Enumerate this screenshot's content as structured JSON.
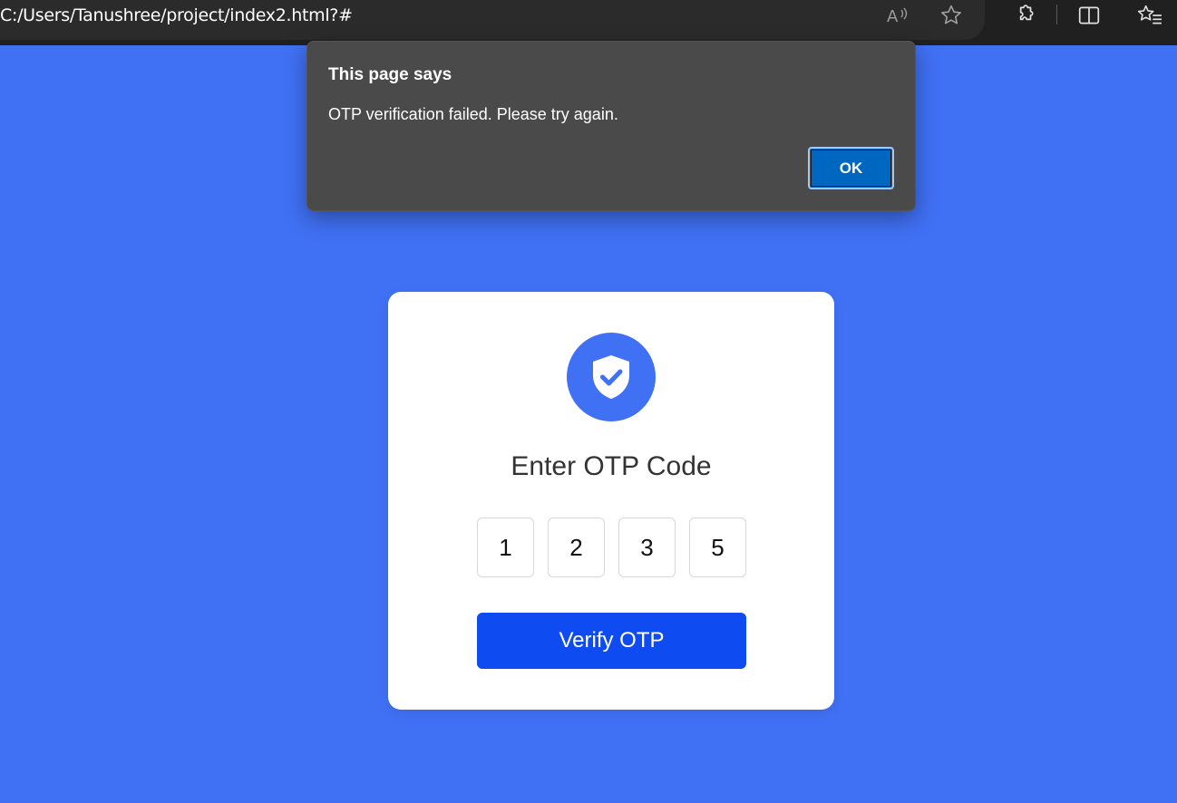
{
  "browser": {
    "url": "C:/Users/Tanushree/project/index2.html?#",
    "icons": [
      "read-aloud-icon",
      "favorite-star-icon",
      "extensions-icon",
      "split-screen-icon",
      "favorites-list-icon"
    ]
  },
  "dialog": {
    "title": "This page says",
    "message": "OTP verification failed. Please try again.",
    "ok_label": "OK"
  },
  "card": {
    "icon": "shield-check-icon",
    "title": "Enter OTP Code",
    "otp_digits": [
      "1",
      "2",
      "3",
      "5"
    ],
    "verify_label": "Verify OTP"
  },
  "colors": {
    "background": "#4070f4",
    "button": "#0e4bf1",
    "dialog_bg": "#4a4a4a",
    "ok_button": "#0067c0"
  }
}
